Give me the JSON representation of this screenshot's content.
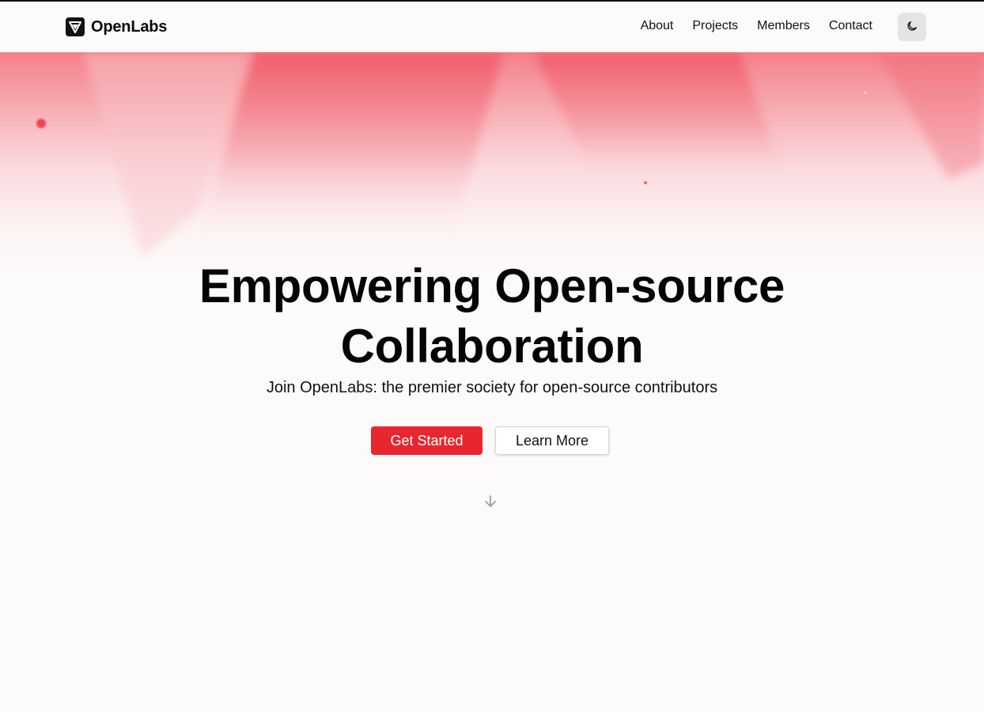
{
  "brand": {
    "name": "OpenLabs",
    "logo_icon": "shield-logo-icon"
  },
  "nav": {
    "items": [
      "About",
      "Projects",
      "Members",
      "Contact"
    ]
  },
  "theme_toggle": {
    "icon": "moon-icon"
  },
  "hero": {
    "headline_line1": "Empowering Open-source",
    "headline_line2": "Collaboration",
    "subtitle": "Join OpenLabs: the premier society for open-source contributors",
    "primary_button": "Get Started",
    "secondary_button": "Learn More",
    "scroll_icon": "arrow-down-icon"
  },
  "colors": {
    "accent": "#e8262f",
    "background": "#fcfbfa",
    "hero_gradient": "#f25563"
  }
}
